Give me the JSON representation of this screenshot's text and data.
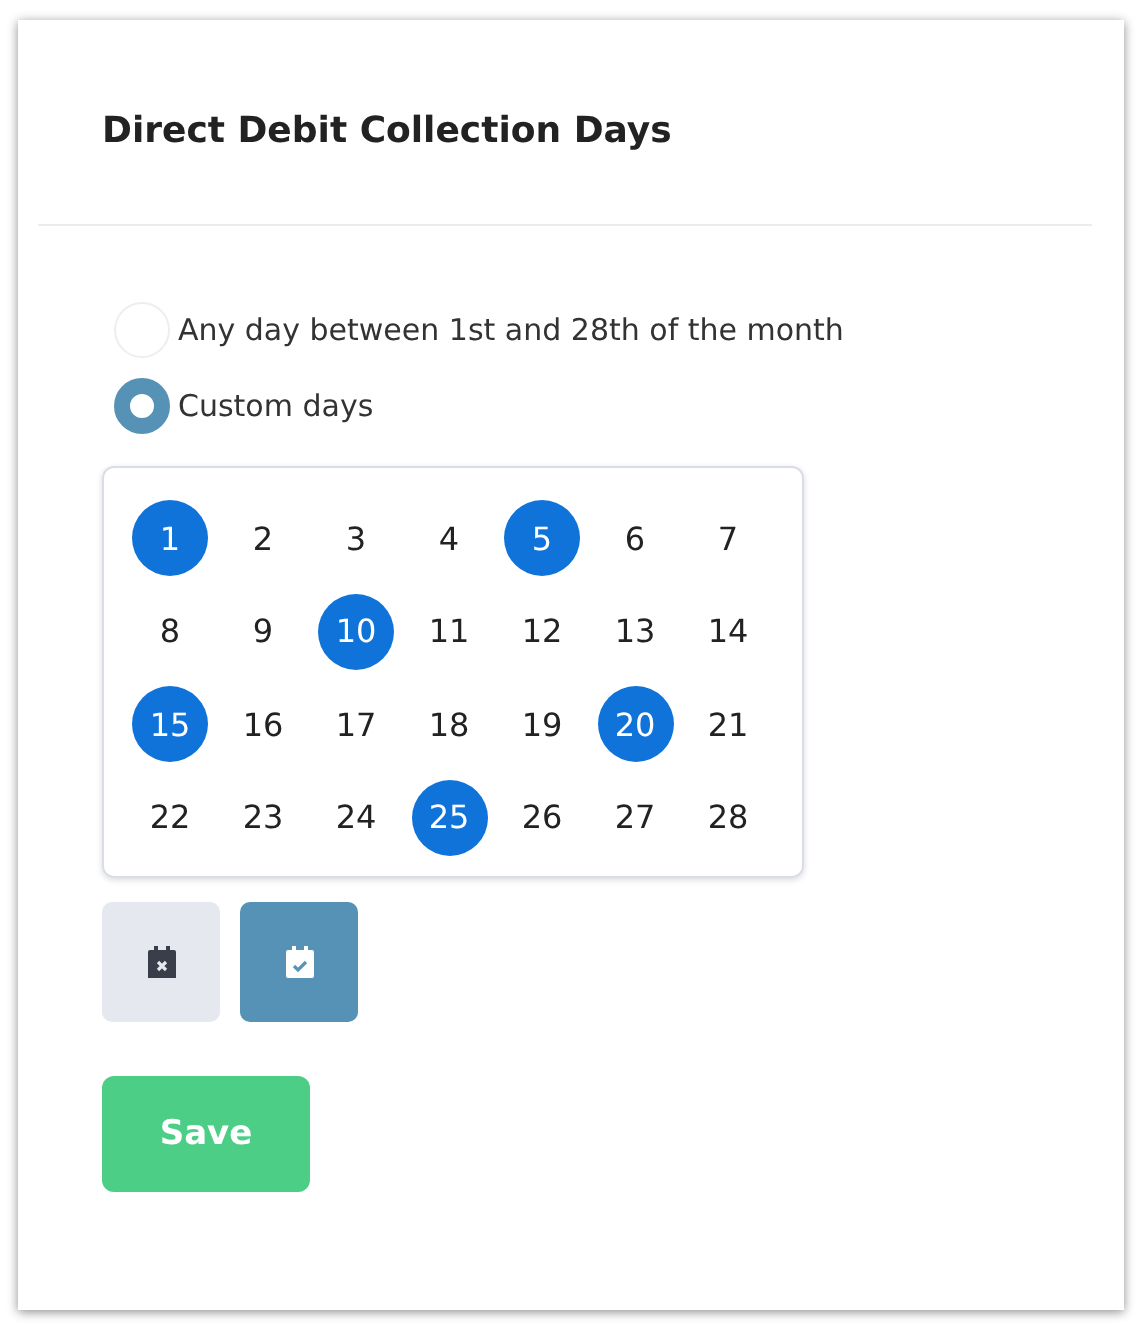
{
  "title": "Direct Debit Collection Days",
  "options": [
    {
      "label": "Any day between 1st and 28th of the month",
      "selected": false
    },
    {
      "label": "Custom days",
      "selected": true
    }
  ],
  "days": [
    {
      "label": "1",
      "selected": true
    },
    {
      "label": "2",
      "selected": false
    },
    {
      "label": "3",
      "selected": false
    },
    {
      "label": "4",
      "selected": false
    },
    {
      "label": "5",
      "selected": true
    },
    {
      "label": "6",
      "selected": false
    },
    {
      "label": "7",
      "selected": false
    },
    {
      "label": "8",
      "selected": false
    },
    {
      "label": "9",
      "selected": false
    },
    {
      "label": "10",
      "selected": true
    },
    {
      "label": "11",
      "selected": false
    },
    {
      "label": "12",
      "selected": false
    },
    {
      "label": "13",
      "selected": false
    },
    {
      "label": "14",
      "selected": false
    },
    {
      "label": "15",
      "selected": true
    },
    {
      "label": "16",
      "selected": false
    },
    {
      "label": "17",
      "selected": false
    },
    {
      "label": "18",
      "selected": false
    },
    {
      "label": "19",
      "selected": false
    },
    {
      "label": "20",
      "selected": true
    },
    {
      "label": "21",
      "selected": false
    },
    {
      "label": "22",
      "selected": false
    },
    {
      "label": "23",
      "selected": false
    },
    {
      "label": "24",
      "selected": false
    },
    {
      "label": "25",
      "selected": true
    },
    {
      "label": "26",
      "selected": false
    },
    {
      "label": "27",
      "selected": false
    },
    {
      "label": "28",
      "selected": false
    }
  ],
  "tools": [
    {
      "kind": "clear"
    },
    {
      "kind": "select-all"
    }
  ],
  "save": "Save"
}
